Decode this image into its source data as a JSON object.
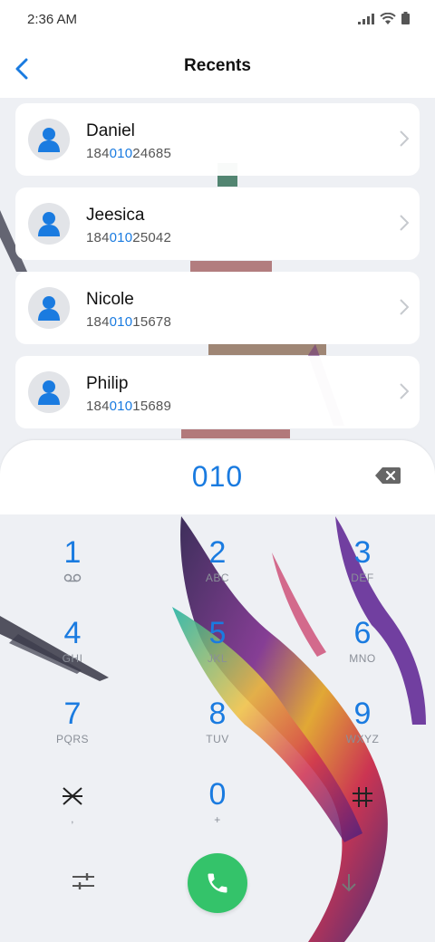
{
  "status_bar": {
    "time": "2:36 AM",
    "icons": [
      "signal-icon",
      "wifi-icon",
      "battery-icon"
    ]
  },
  "header": {
    "title": "Recents",
    "back_icon": "chevron-left-icon"
  },
  "recents": [
    {
      "name": "Daniel",
      "number_prefix": "184",
      "number_match": "010",
      "number_suffix": "24685"
    },
    {
      "name": "Jeesica",
      "number_prefix": "184",
      "number_match": "010",
      "number_suffix": "25042"
    },
    {
      "name": "Nicole",
      "number_prefix": "184",
      "number_match": "010",
      "number_suffix": "15678"
    },
    {
      "name": "Philip",
      "number_prefix": "184",
      "number_match": "010",
      "number_suffix": "15689"
    }
  ],
  "dialer": {
    "input_value": "010",
    "backspace_icon": "backspace-icon"
  },
  "keypad": [
    {
      "digit": "1",
      "letters": "",
      "icon": "voicemail-icon"
    },
    {
      "digit": "2",
      "letters": "ABC"
    },
    {
      "digit": "3",
      "letters": "DEF"
    },
    {
      "digit": "4",
      "letters": "GHI"
    },
    {
      "digit": "5",
      "letters": "JKL"
    },
    {
      "digit": "6",
      "letters": "MNO"
    },
    {
      "digit": "7",
      "letters": "PQRS"
    },
    {
      "digit": "8",
      "letters": "TUV"
    },
    {
      "digit": "9",
      "letters": "WXYZ"
    },
    {
      "digit": "*",
      "letters": ","
    },
    {
      "digit": "0",
      "letters": "+"
    },
    {
      "digit": "#",
      "letters": ""
    }
  ],
  "actions": {
    "settings_icon": "sliders-icon",
    "call_icon": "phone-icon",
    "hide_icon": "arrow-down-icon"
  },
  "colors": {
    "accent": "#1a7be0",
    "call": "#34c36a",
    "background": "#eef0f4"
  }
}
